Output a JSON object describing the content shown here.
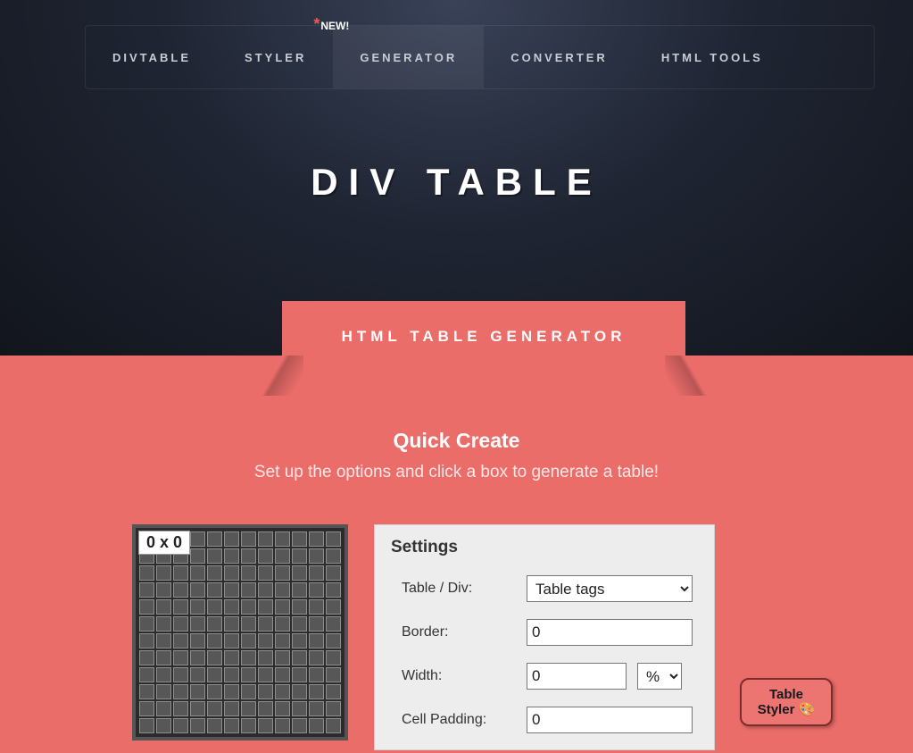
{
  "nav": {
    "items": [
      "DIVTABLE",
      "STYLER",
      "GENERATOR",
      "CONVERTER",
      "HTML TOOLS"
    ],
    "new_badge": "NEW!",
    "active_index": 2
  },
  "page_title": "DIV TABLE",
  "tab_banner": "HTML TABLE GENERATOR",
  "quick": {
    "title": "Quick Create",
    "subtitle": "Set up the options and click a box to generate a table!"
  },
  "grid": {
    "label": "0 x 0",
    "cols": 12,
    "rows": 12
  },
  "settings": {
    "heading": "Settings",
    "rows": [
      {
        "label": "Table / Div:"
      },
      {
        "label": "Border:"
      },
      {
        "label": "Width:"
      },
      {
        "label": "Cell Padding:"
      }
    ],
    "table_div_value": "Table tags",
    "border_value": "0",
    "width_value": "0",
    "width_unit": "%",
    "cellpadding_value": "0"
  },
  "floating": {
    "line1": "Table",
    "line2": "Styler 🎨"
  }
}
